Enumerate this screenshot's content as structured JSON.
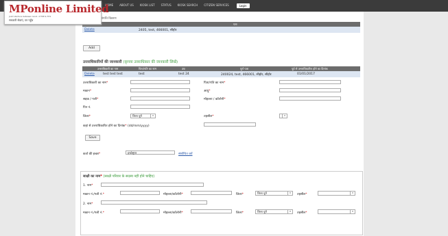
{
  "header": {
    "brand": "MPonline Limited",
    "subtitle": "Joint Venture between Govt. of MP & TCS",
    "tagline": "सरकारी सेवाएं, घर पहुँच",
    "nav": [
      "HOME",
      "ABOUT US",
      "KIOSK LIST",
      "STATUS",
      "KIOSK SEARCH",
      "CITIZEN SERVICES"
    ],
    "login": "Login"
  },
  "top_table": {
    "partial_label": "संपत्ति विवरण",
    "header": "पता",
    "row": {
      "action": "Delete",
      "address": "2405, test, 466001, सीहोर"
    },
    "add_button": "Add"
  },
  "heirs": {
    "title": "उत्तराधिकारियों की जानकारी",
    "note": "(कृपया उत्तराधिकार की जानकारी लिखें)",
    "columns": [
      "",
      "उत्तराधिकारी का नाम",
      "पिता/पति का नाम",
      "उम्र",
      "पूर्ण पता",
      "पूर्व से उत्तराधिकारित होने का दिनांक"
    ],
    "row": {
      "action": "Delete",
      "name": "test test test",
      "father": "test",
      "age": "test 24",
      "address": "240024, test, 466001, सीहोर, सीहोर",
      "date": "01/01/2017"
    },
    "form": {
      "name_label": "उत्तराधिकारी का नाम",
      "father_label": "पिता/पति का नाम",
      "house_label": "मकान",
      "age_label": "आयु",
      "street_label": "सड़क / गली",
      "locality_label": "मोहल्ला / कॉलोनी",
      "pin_label": "पिन नं.",
      "district_label": "जिला",
      "district_value": "जिला चुनें",
      "tehsil_label": "तहसील",
      "date_label": "कहां से उत्तराधिकारित होने का दिनांक",
      "date_hint": "(dd/mm/yyyy)",
      "save_button": "Save"
    }
  },
  "applicant": {
    "label": "कर्ता की इच्छा",
    "value": "इन्डोसुपर",
    "link": "संशोधित करें"
  },
  "witness": {
    "title": "साक्षी का नाम",
    "note": "(साक्षी परिवार के सदस्य नहीं होने चाहिए)",
    "w1_label": "1. नाम",
    "w2_label": "2. नाम",
    "house_label": "मकान नं./गली नं.",
    "locality_label": "मोहल्ला/कॉलोनी",
    "district_label": "जिला",
    "district_value": "जिला चुनें",
    "tehsil_label": "तहसील"
  }
}
